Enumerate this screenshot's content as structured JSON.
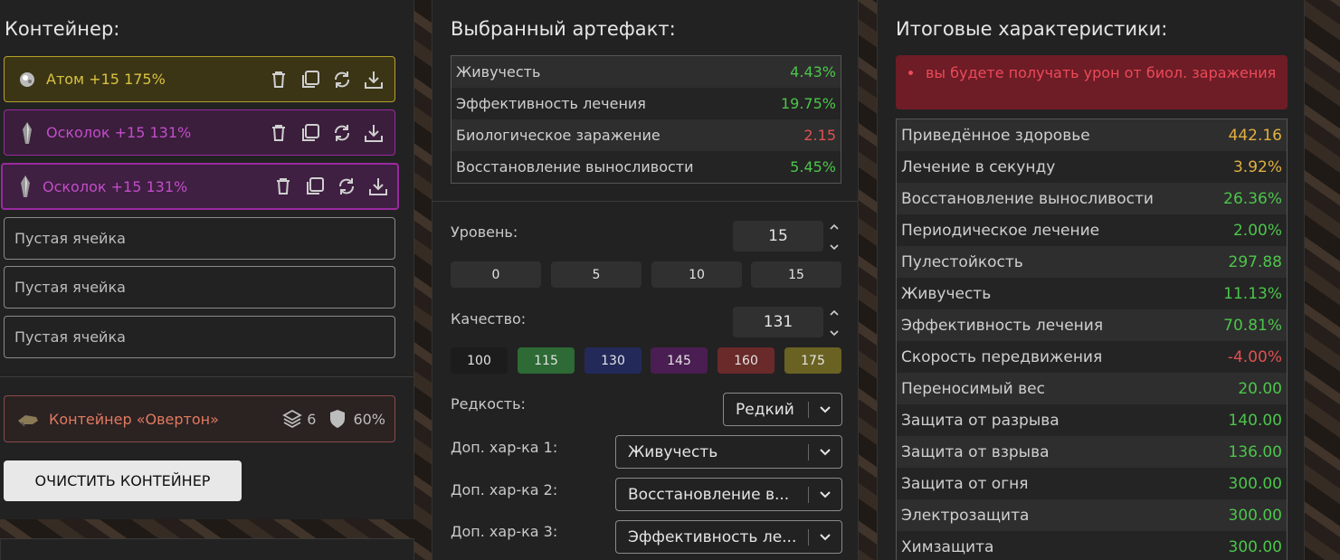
{
  "container_panel": {
    "title": "Контейнер:",
    "slots": [
      {
        "name": "Атом +15 175%",
        "icon": "atom-artifact-icon"
      },
      {
        "name": "Осколок +15 131%",
        "icon": "shard-artifact-icon"
      },
      {
        "name": "Осколок +15 131%",
        "icon": "shard-artifact-icon"
      }
    ],
    "empty_slots": [
      "Пустая ячейка",
      "Пустая ячейка",
      "Пустая ячейка"
    ],
    "container": {
      "name": "Контейнер «Овертон»",
      "capacity": "6",
      "protection": "60%"
    },
    "clear_button": "ОЧИСТИТЬ КОНТЕЙНЕР"
  },
  "artifact_panel": {
    "title": "Выбранный артефакт:",
    "stats": [
      {
        "name": "Живучесть",
        "value": "4.43%",
        "tone": "green"
      },
      {
        "name": "Эффективность лечения",
        "value": "19.75%",
        "tone": "green"
      },
      {
        "name": "Биологическое заражение",
        "value": "2.15",
        "tone": "red"
      },
      {
        "name": "Восстановление выносливости",
        "value": "5.45%",
        "tone": "green"
      }
    ],
    "level": {
      "label": "Уровень:",
      "value": "15",
      "presets": [
        "0",
        "5",
        "10",
        "15"
      ]
    },
    "quality": {
      "label": "Качество:",
      "value": "131",
      "presets": [
        {
          "value": "100",
          "color": "#1c1c1c"
        },
        {
          "value": "115",
          "color": "#2d6a35"
        },
        {
          "value": "130",
          "color": "#232a5a"
        },
        {
          "value": "145",
          "color": "#4a1e52"
        },
        {
          "value": "160",
          "color": "#6a2a2a"
        },
        {
          "value": "175",
          "color": "#6a6222"
        }
      ]
    },
    "rarity": {
      "label": "Редкость:",
      "value": "Редкий"
    },
    "extra": [
      {
        "label": "Доп. хар-ка 1:",
        "value": "Живучесть"
      },
      {
        "label": "Доп. хар-ка 2:",
        "value": "Восстановление в..."
      },
      {
        "label": "Доп. хар-ка 3:",
        "value": "Эффективность ле..."
      }
    ]
  },
  "totals_panel": {
    "title": "Итоговые характеристики:",
    "warning": "вы будете получать урон от биол. заражения",
    "stats": [
      {
        "name": "Приведённое здоровье",
        "value": "442.16",
        "tone": "gold"
      },
      {
        "name": "Лечение в секунду",
        "value": "3.92%",
        "tone": "gold"
      },
      {
        "name": "Восстановление выносливости",
        "value": "26.36%",
        "tone": "green"
      },
      {
        "name": "Периодическое лечение",
        "value": "2.00%",
        "tone": "green"
      },
      {
        "name": "Пулестойкость",
        "value": "297.88",
        "tone": "green"
      },
      {
        "name": "Живучесть",
        "value": "11.13%",
        "tone": "green"
      },
      {
        "name": "Эффективность лечения",
        "value": "70.81%",
        "tone": "green"
      },
      {
        "name": "Скорость передвижения",
        "value": "-4.00%",
        "tone": "red"
      },
      {
        "name": "Переносимый вес",
        "value": "20.00",
        "tone": "green"
      },
      {
        "name": "Защита от разрыва",
        "value": "140.00",
        "tone": "green"
      },
      {
        "name": "Защита от взрыва",
        "value": "136.00",
        "tone": "green"
      },
      {
        "name": "Защита от огня",
        "value": "300.00",
        "tone": "green"
      },
      {
        "name": "Электрозащита",
        "value": "300.00",
        "tone": "green"
      },
      {
        "name": "Химзащита",
        "value": "300.00",
        "tone": "green"
      }
    ]
  }
}
